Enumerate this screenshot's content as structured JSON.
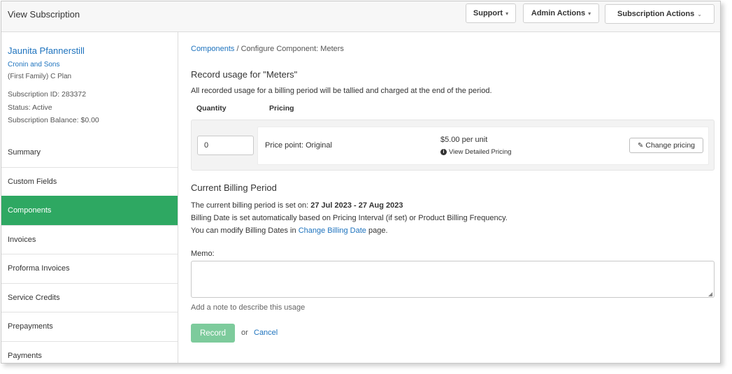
{
  "header": {
    "title": "View Subscription",
    "support_label": "Support",
    "admin_actions_label": "Admin Actions",
    "subscription_actions_label": "Subscription Actions"
  },
  "customer": {
    "name": "Jaunita Pfannerstill",
    "company": "Cronin and Sons",
    "plan": "(First Family) C Plan",
    "subscription_id": "Subscription ID: 283372",
    "status": "Status: Active",
    "balance": "Subscription Balance: $0.00"
  },
  "nav": {
    "items": [
      {
        "label": "Summary"
      },
      {
        "label": "Custom Fields"
      },
      {
        "label": "Components"
      },
      {
        "label": "Invoices"
      },
      {
        "label": "Proforma Invoices"
      },
      {
        "label": "Service Credits"
      },
      {
        "label": "Prepayments"
      },
      {
        "label": "Payments"
      }
    ],
    "active": "Components"
  },
  "breadcrumb": {
    "link": "Components",
    "separator": "/",
    "current": "Configure Component: Meters"
  },
  "record": {
    "title": "Record usage for \"Meters\"",
    "description": "All recorded usage for a billing period will be tallied and charged at the end of the period.",
    "quantity_header": "Quantity",
    "pricing_header": "Pricing",
    "quantity_value": "0",
    "price_point": "Price point: Original",
    "rate": "$5.00 per unit",
    "detailed_pricing_link": "View Detailed Pricing",
    "change_pricing_label": "Change pricing"
  },
  "billing": {
    "title": "Current Billing Period",
    "period_prefix": "The current billing period is set on:",
    "period_value": "27 Jul 2023 - 27 Aug 2023",
    "auto_note": "Billing Date is set automatically based on Pricing Interval (if set) or Product Billing Frequency.",
    "modify_prefix": "You can modify Billing Dates in",
    "modify_link": "Change Billing Date",
    "modify_suffix": "page."
  },
  "memo": {
    "label": "Memo:",
    "value": "",
    "help": "Add a note to describe this usage"
  },
  "actions": {
    "record_label": "Record",
    "or_text": "or",
    "cancel_label": "Cancel"
  },
  "colors": {
    "accent_green": "#2ea862",
    "record_button": "#7dcb9c",
    "link_blue": "#1e73be"
  }
}
